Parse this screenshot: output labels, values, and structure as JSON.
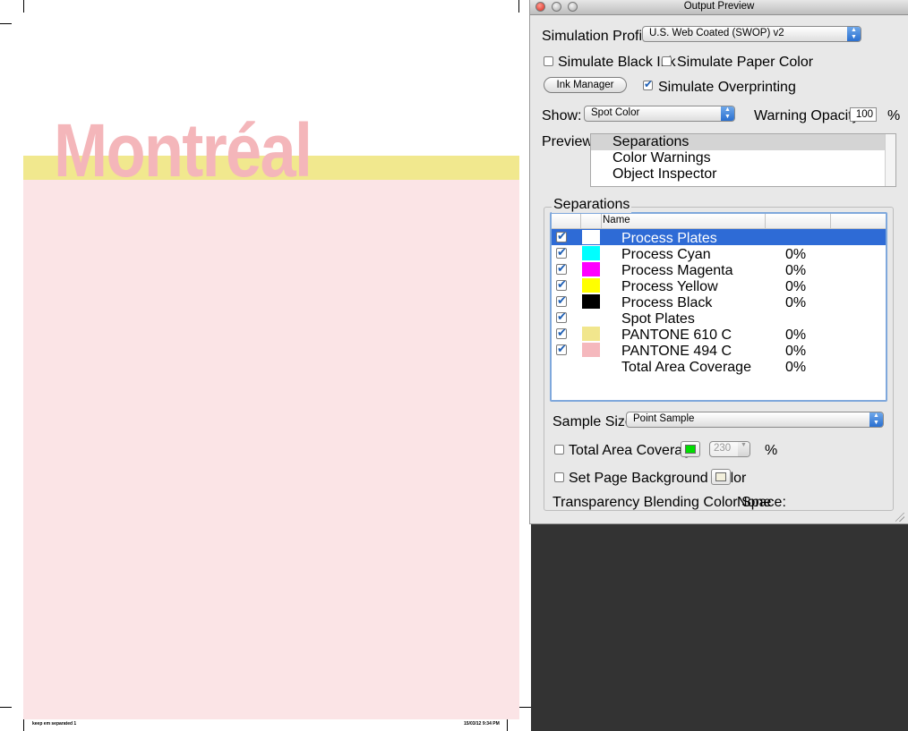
{
  "document": {
    "title": "Montréal",
    "slug_left": "keep em separated   1",
    "slug_right": "15/03/12   9:34 PM"
  },
  "panel": {
    "window_title": "Output Preview",
    "simulation_profile_label": "Simulation Profile:",
    "simulation_profile_value": "U.S. Web Coated (SWOP) v2",
    "simulate_black_ink_label": "Simulate Black Ink",
    "simulate_black_ink_checked": false,
    "simulate_paper_color_label": "Simulate Paper Color",
    "simulate_paper_color_checked": false,
    "ink_manager_label": "Ink Manager",
    "simulate_overprinting_label": "Simulate Overprinting",
    "simulate_overprinting_checked": true,
    "show_label": "Show:",
    "show_value": "Spot Color",
    "warning_opacity_label": "Warning Opacity:",
    "warning_opacity_value": "100",
    "percent_sign": "%",
    "preview_label": "Preview:",
    "preview_items": [
      {
        "label": "Separations",
        "selected": true
      },
      {
        "label": "Color Warnings",
        "selected": false
      },
      {
        "label": "Object Inspector",
        "selected": false
      }
    ],
    "separations_group_label": "Separations",
    "table_header_name": "Name",
    "separations": [
      {
        "name": "Process Plates",
        "coverage": "",
        "swatch": "#ffffff",
        "checked": true,
        "selected": true
      },
      {
        "name": "Process Cyan",
        "coverage": "0%",
        "swatch": "#00ffff",
        "checked": true,
        "selected": false
      },
      {
        "name": "Process Magenta",
        "coverage": "0%",
        "swatch": "#ff00ff",
        "checked": true,
        "selected": false
      },
      {
        "name": "Process Yellow",
        "coverage": "0%",
        "swatch": "#ffff00",
        "checked": true,
        "selected": false
      },
      {
        "name": "Process Black",
        "coverage": "0%",
        "swatch": "#000000",
        "checked": true,
        "selected": false
      },
      {
        "name": "Spot Plates",
        "coverage": "",
        "swatch": "",
        "checked": true,
        "selected": false
      },
      {
        "name": "PANTONE 610 C",
        "coverage": "0%",
        "swatch": "#f1e68d",
        "checked": true,
        "selected": false
      },
      {
        "name": "PANTONE 494 C",
        "coverage": "0%",
        "swatch": "#f5b8bd",
        "checked": true,
        "selected": false
      },
      {
        "name": "Total Area Coverage",
        "coverage": "0%",
        "swatch": "",
        "checked": false,
        "selected": false
      }
    ],
    "sample_size_label": "Sample Size:",
    "sample_size_value": "Point Sample",
    "total_area_coverage_label": "Total Area Coverage",
    "total_area_coverage_checked": false,
    "tac_color": "#00dd00",
    "tac_value": "230",
    "tac_percent": "%",
    "set_page_bg_label": "Set Page Background Color",
    "set_page_bg_checked": false,
    "page_bg_color": "#f3f0dc",
    "transparency_label": "Transparency Blending Color Space:",
    "transparency_value": "None"
  }
}
